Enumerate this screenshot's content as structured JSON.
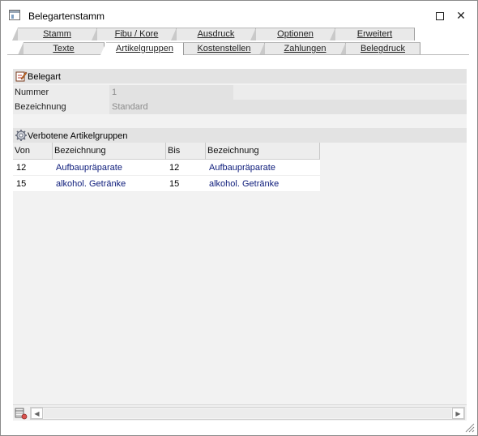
{
  "window": {
    "title": "Belegartenstamm",
    "maximize_glyph": "",
    "close_glyph": "✕"
  },
  "tabs": {
    "upper": [
      "Stamm",
      "Fibu / Kore",
      "Ausdruck",
      "Optionen",
      "Erweitert"
    ],
    "lower": [
      "Texte",
      "Artikelgruppen",
      "Kostenstellen",
      "Zahlungen",
      "Belegdruck"
    ],
    "active": "Artikelgruppen"
  },
  "belegart": {
    "heading": "Belegart",
    "icon": "edit-document-icon",
    "nummer_label": "Nummer",
    "nummer_value": "1",
    "bezeichnung_label": "Bezeichnung",
    "bezeichnung_value": "Standard"
  },
  "verbotene": {
    "heading": "Verbotene Artikelgruppen",
    "icon": "gear-icon",
    "columns": [
      "Von",
      "Bezeichnung",
      "Bis",
      "Bezeichnung"
    ],
    "rows": [
      {
        "von": "12",
        "von_bez": "Aufbaupräparate",
        "bis": "12",
        "bis_bez": "Aufbaupräparate"
      },
      {
        "von": "15",
        "von_bez": "alkohol. Getränke",
        "bis": "15",
        "bis_bez": "alkohol. Getränke"
      }
    ]
  },
  "colors": {
    "link_text": "#0b1a7a",
    "section_bg": "#e3e3e3",
    "panel_bg": "#f2f2f2"
  }
}
